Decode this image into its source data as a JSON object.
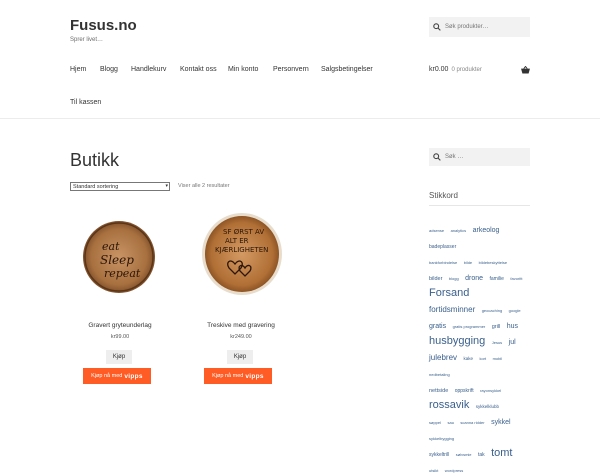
{
  "site": {
    "title": "Fusus.no",
    "tagline": "Sprer livet…"
  },
  "header_search": {
    "placeholder": "Søk produkter…",
    "icon": "search-icon"
  },
  "nav": {
    "items": [
      "Hjem",
      "Blogg",
      "Handlekurv",
      "Kontakt oss",
      "Min konto",
      "Personvern",
      "Salgsbetingelser",
      "Til kassen"
    ]
  },
  "cart": {
    "amount": "kr0.00",
    "count": "0 produkter",
    "icon": "basket-icon"
  },
  "main": {
    "title": "Butikk",
    "sort_selected": "Standard sortering",
    "results_text": "Viser alle 2 resultater",
    "products": [
      {
        "name": "Gravert gryteunderlag",
        "price": "kr99.00",
        "buy_label": "Kjøp",
        "vipps_prefix": "Kjøp nå med",
        "vipps_brand": "vipps",
        "image_text": "Eat Sleep Repeat"
      },
      {
        "name": "Treskive med gravering",
        "price": "kr249.00",
        "buy_label": "Kjøp",
        "vipps_prefix": "Kjøp nå med",
        "vipps_brand": "vipps",
        "image_text": "SF ØRST AV ALT ER KJÆRLIGHETEN"
      }
    ]
  },
  "sidebar": {
    "search_placeholder": "Søk …",
    "tag_title": "Stikkord",
    "tags": [
      "adsense",
      "analytics",
      "arkeolog",
      "badeplasser",
      "bankforbindelse",
      "bilde",
      "bildebeskyttelse",
      "bilder",
      "blogg",
      "drone",
      "familie",
      "favoritt",
      "Forsand",
      "fortidsminner",
      "geocaching",
      "google",
      "gratis",
      "gratis programmer",
      "grill",
      "hus",
      "husbygging",
      "Jesus",
      "jul",
      "julebrev",
      "kake",
      "kort",
      "mobil",
      "nedbetaling",
      "nettside",
      "oppskrift",
      "rayonsykkel",
      "rossavik",
      "sykkel",
      "sykkelklubb",
      "søppel",
      "sau",
      "scanna ridder",
      "sykkel",
      "sykkel tur",
      "sykkelbygging",
      "sykkeltrill",
      "sølvsmie",
      "tak",
      "tomt",
      "utsikt",
      "wordpress"
    ]
  },
  "colors": {
    "accent": "#ff5b24",
    "link": "#3a5f8c",
    "text": "#43454b"
  }
}
